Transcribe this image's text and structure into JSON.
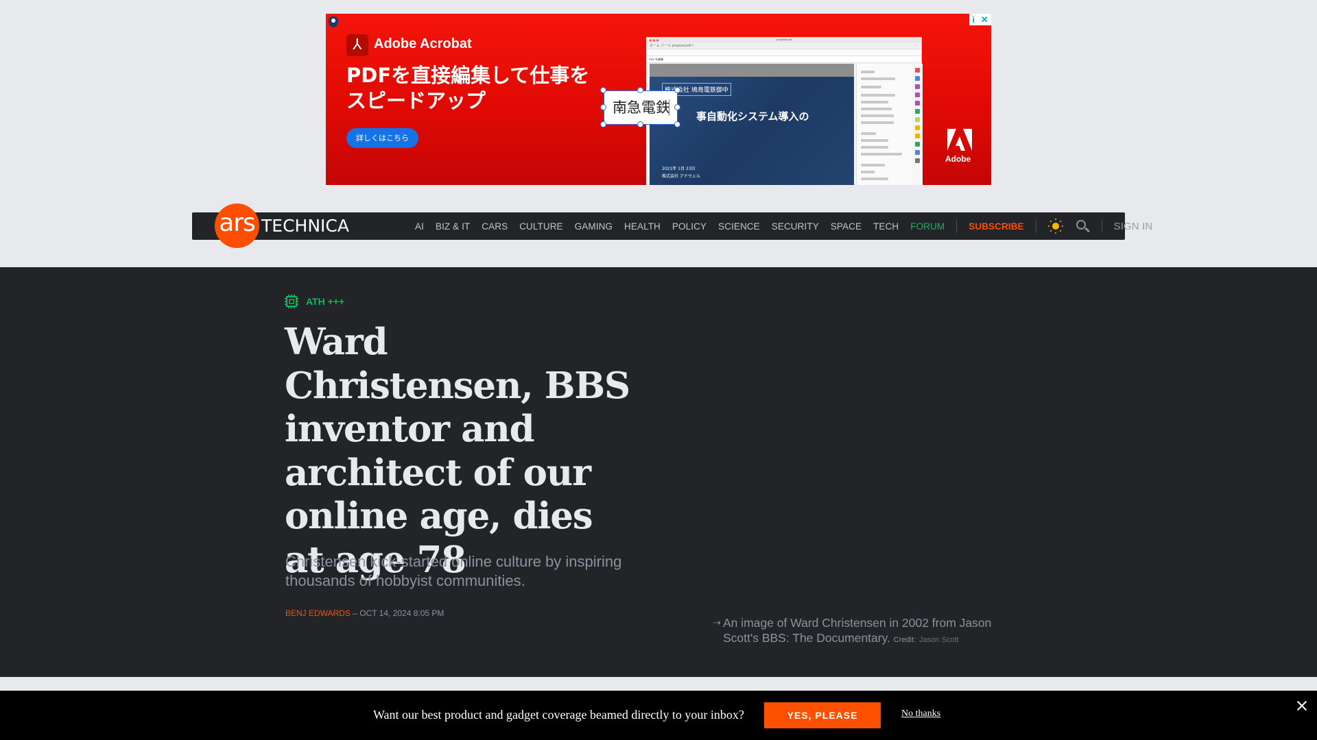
{
  "ad": {
    "brand_name": "Adobe Acrobat",
    "headline": "PDFを直接編集して仕事をスピードアップ",
    "cta_label": "詳しくはこちら",
    "callout_text": "南急電鉄",
    "doc_line_1": "株式会社 鳩島電鉄御中",
    "doc_line_2": "事自動化システム導入の",
    "doc_date": "2021年 1月 23日",
    "doc_company": "株式会社 アドウェル",
    "window_title": "proposal.pdf",
    "tab_label": "ホーム  ツール    proposal.pdf  ×",
    "toolbar_label": "PDF を編集",
    "adobe_wordmark": "Adobe",
    "adchoices_info": "i",
    "adchoices_close": "✕",
    "colors": {
      "background": "#e00a04",
      "cta": "#1473e6"
    }
  },
  "nav": {
    "logo_ars": "ars",
    "logo_technica": "TECHNICA",
    "links": [
      {
        "label": "AI"
      },
      {
        "label": "BIZ & IT"
      },
      {
        "label": "CARS"
      },
      {
        "label": "CULTURE"
      },
      {
        "label": "GAMING"
      },
      {
        "label": "HEALTH"
      },
      {
        "label": "POLICY"
      },
      {
        "label": "SCIENCE"
      },
      {
        "label": "SECURITY"
      },
      {
        "label": "SPACE"
      },
      {
        "label": "TECH"
      }
    ],
    "forum_label": "FORUM",
    "subscribe_label": "SUBSCRIBE",
    "theme_icon": "sun-icon",
    "search_icon": "search-icon",
    "signin_label": "SIGN IN",
    "colors": {
      "brand": "#ff4e00",
      "forum": "#12b461",
      "bar": "#232428"
    }
  },
  "article": {
    "category": "ATH +++",
    "category_icon": "chip-icon",
    "title": "Ward Christensen, BBS inventor and architect of our online age, dies at age 78",
    "dek": "Christensen kick-started online culture by inspiring thousands of hobbyist communities.",
    "author": "BENJ EDWARDS",
    "separator": " – ",
    "date": "OCT 14, 2024 8:05 PM",
    "caption": {
      "arrow": "⇢",
      "text": "An image of Ward Christensen in 2002 from Jason Scott's BBS: The Documentary.",
      "credit_label": "Credit:",
      "credit_name": "Jason Scott"
    }
  },
  "newsletter": {
    "prompt": "Want our best product and gadget coverage beamed directly to your inbox?",
    "accept_label": "YES, PLEASE",
    "decline_label": "No thanks",
    "accent": "#ff5000"
  }
}
